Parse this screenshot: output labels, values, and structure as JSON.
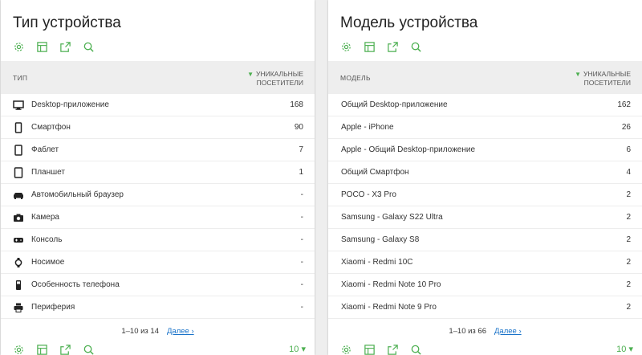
{
  "colors": {
    "accent": "#4caf50",
    "link": "#1a73c9",
    "header_bg": "#eeeeee"
  },
  "left": {
    "title": "Тип устройства",
    "toolbar_icons": [
      "gear-icon",
      "table-icon",
      "export-icon",
      "search-icon"
    ],
    "column_label": "ТИП",
    "metric_line1": "УНИКАЛЬНЫЕ",
    "metric_line2": "ПОСЕТИТЕЛИ",
    "rows": [
      {
        "icon": "desktop-icon",
        "label": "Desktop-приложение",
        "value": "168"
      },
      {
        "icon": "smartphone-icon",
        "label": "Смартфон",
        "value": "90"
      },
      {
        "icon": "phablet-icon",
        "label": "Фаблет",
        "value": "7"
      },
      {
        "icon": "tablet-icon",
        "label": "Планшет",
        "value": "1"
      },
      {
        "icon": "car-icon",
        "label": "Автомобильный браузер",
        "value": "-"
      },
      {
        "icon": "camera-icon",
        "label": "Камера",
        "value": "-"
      },
      {
        "icon": "console-icon",
        "label": "Консоль",
        "value": "-"
      },
      {
        "icon": "watch-icon",
        "label": "Носимое",
        "value": "-"
      },
      {
        "icon": "feature-phone-icon",
        "label": "Особенность телефона",
        "value": "-"
      },
      {
        "icon": "printer-icon",
        "label": "Периферия",
        "value": "-"
      }
    ],
    "pager_text": "1–10 из 14",
    "next_label": "Далее ›",
    "limit_value": "10"
  },
  "right": {
    "title": "Модель устройства",
    "toolbar_icons": [
      "gear-icon",
      "table-icon",
      "export-icon",
      "search-icon"
    ],
    "column_label": "МОДЕЛЬ",
    "metric_line1": "УНИКАЛЬНЫЕ",
    "metric_line2": "ПОСЕТИТЕЛИ",
    "rows": [
      {
        "label": "Общий Desktop-приложение",
        "value": "162"
      },
      {
        "label": "Apple - iPhone",
        "value": "26"
      },
      {
        "label": "Apple - Общий Desktop-приложение",
        "value": "6"
      },
      {
        "label": "Общий Смартфон",
        "value": "4"
      },
      {
        "label": "POCO - X3 Pro",
        "value": "2"
      },
      {
        "label": "Samsung - Galaxy S22 Ultra",
        "value": "2"
      },
      {
        "label": "Samsung - Galaxy S8",
        "value": "2"
      },
      {
        "label": "Xiaomi - Redmi 10C",
        "value": "2"
      },
      {
        "label": "Xiaomi - Redmi Note 10 Pro",
        "value": "2"
      },
      {
        "label": "Xiaomi - Redmi Note 9 Pro",
        "value": "2"
      }
    ],
    "pager_text": "1–10 из 66",
    "next_label": "Далее ›",
    "limit_value": "10"
  }
}
